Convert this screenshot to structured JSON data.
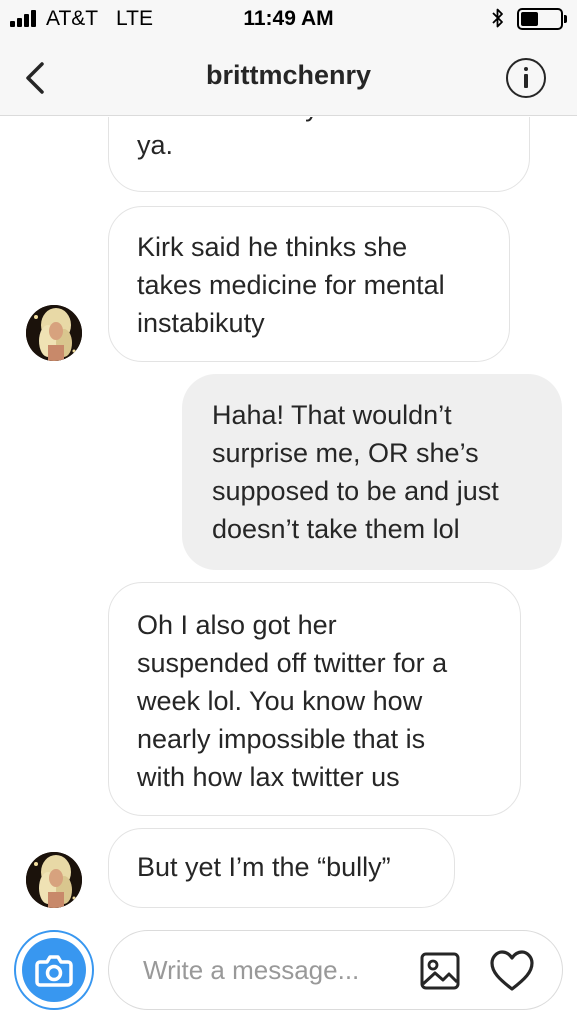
{
  "status_bar": {
    "carrier": "AT&T",
    "network": "LTE",
    "time": "11:49 AM",
    "signal_bars": 4,
    "battery_level": 0.4,
    "bluetooth_icon": "bluetooth-icon"
  },
  "header": {
    "title": "brittmchenry",
    "back_icon": "chevron-left-icon",
    "info_icon": "info-icon"
  },
  "messages": [
    {
      "sender": "them",
      "lines": [
        "I think she may be on meds",
        "ya."
      ]
    },
    {
      "sender": "them",
      "lines": [
        "Kirk said he thinks she",
        "takes medicine for mental",
        "instabikuty"
      ]
    },
    {
      "sender": "me",
      "lines": [
        "Haha! That wouldn’t",
        "surprise me, OR she’s",
        "supposed to be and just",
        "doesn’t take them lol"
      ]
    },
    {
      "sender": "them",
      "lines": [
        "Oh I also got her",
        "suspended off twitter for a",
        "week lol. You know how",
        "nearly impossible that is",
        "with how lax twitter us"
      ]
    },
    {
      "sender": "them",
      "lines": [
        "But yet I’m the “bully”"
      ]
    }
  ],
  "composer": {
    "placeholder": "Write a message...",
    "camera_icon": "camera-icon",
    "gallery_icon": "image-icon",
    "heart_icon": "heart-icon"
  },
  "colors": {
    "accent": "#3897f0",
    "outgoing_bubble": "#efefef",
    "incoming_border": "#e3e3e3",
    "text": "#262626",
    "placeholder": "#999999"
  }
}
